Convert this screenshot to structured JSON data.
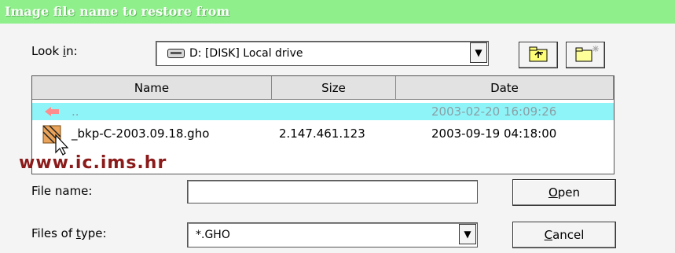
{
  "window": {
    "title": "Image file name to restore from"
  },
  "look_in": {
    "label_pre": "Look ",
    "label_accel": "i",
    "label_post": "n:",
    "value": "D: [DISK] Local drive",
    "drive_icon": "drive-icon"
  },
  "toolbar": {
    "up_icon": "up-folder-icon",
    "new_icon": "new-folder-icon"
  },
  "list": {
    "columns": [
      "Name",
      "Size",
      "Date"
    ],
    "rows": [
      {
        "name": "..",
        "size": "",
        "date": "2003-02-20 16:09:26",
        "icon": "back-arrow-icon"
      },
      {
        "name": "_bkp-C-2003.09.18.gho",
        "size": "2.147.461.123",
        "date": "2003-09-19 04:18:00",
        "icon": "ghost-image-icon"
      }
    ]
  },
  "watermark": "www.ic.ims.hr",
  "file_name": {
    "label": "File name:",
    "value": ""
  },
  "files_of_type": {
    "label_pre": "Files of ",
    "label_accel": "t",
    "label_post": "ype:",
    "value": "*.GHO"
  },
  "buttons": {
    "open_accel": "O",
    "open_rest": "pen",
    "cancel_accel": "C",
    "cancel_rest": "ancel"
  },
  "colors": {
    "title_bar": "#8ff08b",
    "selection": "#8ff4f8",
    "watermark": "#8b1a1a"
  }
}
